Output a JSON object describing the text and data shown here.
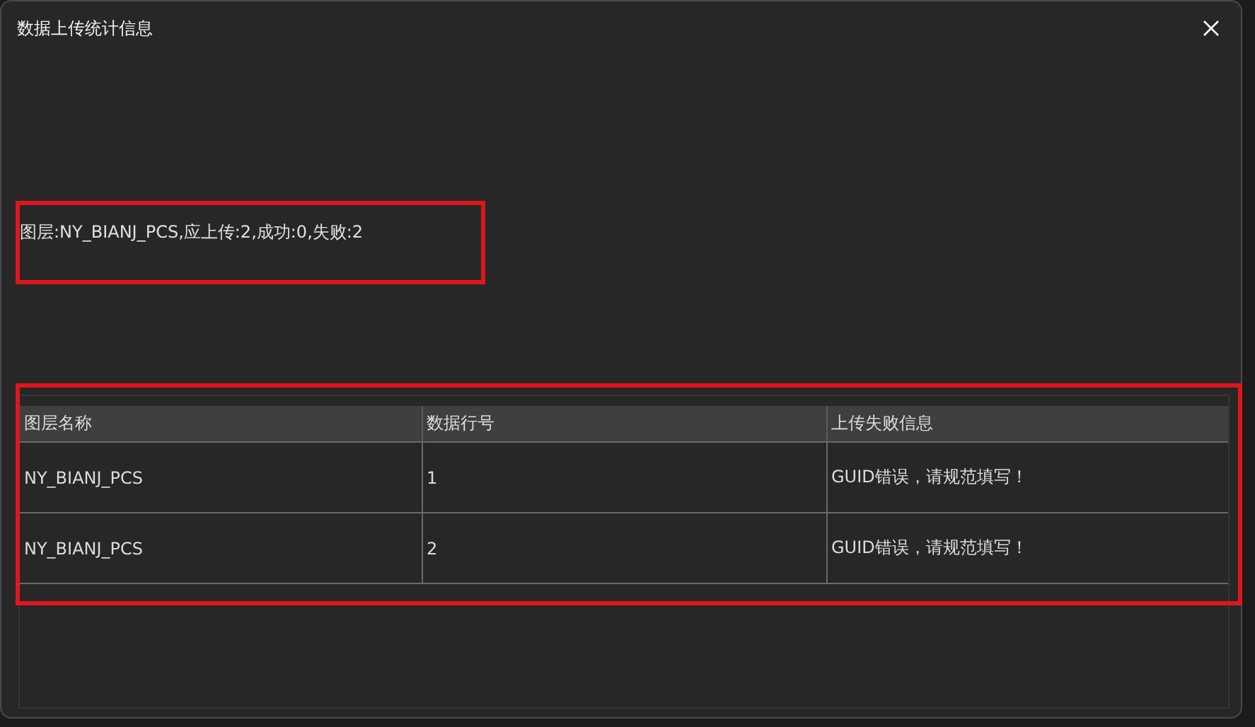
{
  "window": {
    "title": "数据上传统计信息"
  },
  "summary": "图层:NY_BIANJ_PCS,应上传:2,成功:0,失败:2",
  "table": {
    "columns": [
      "图层名称",
      "数据行号",
      "上传失败信息"
    ],
    "rows": [
      [
        "NY_BIANJ_PCS",
        "1",
        "GUID错误，请规范填写！"
      ],
      [
        "NY_BIANJ_PCS",
        "2",
        "GUID错误，请规范填写！"
      ]
    ]
  }
}
